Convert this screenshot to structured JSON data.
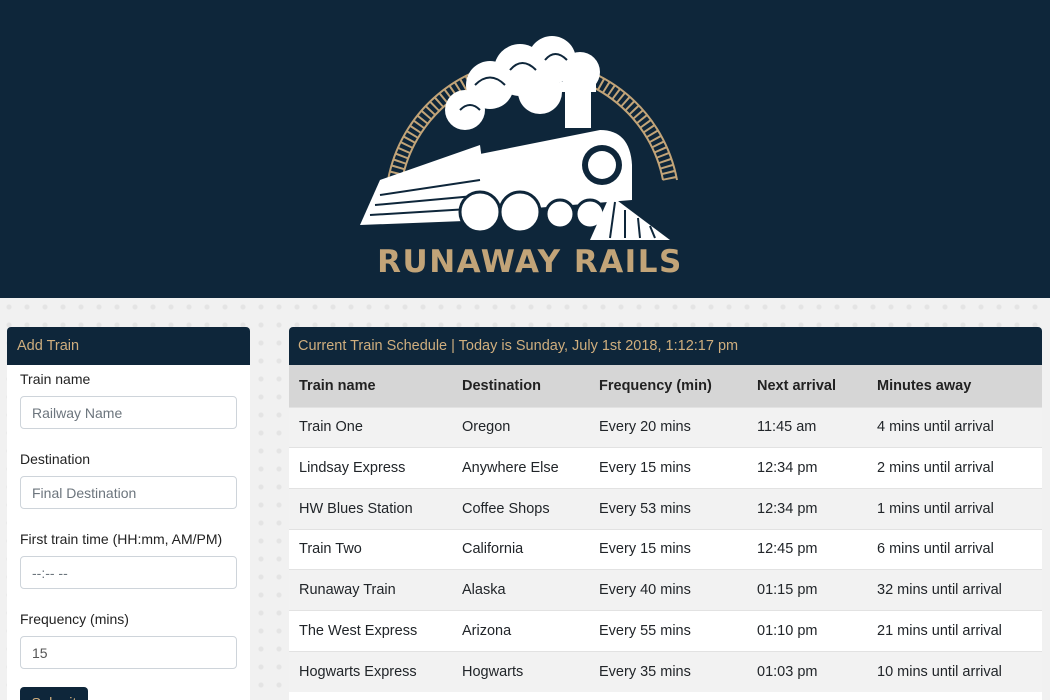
{
  "brand": {
    "name": "RUNAWAY RAILS"
  },
  "colors": {
    "navy": "#0e263a",
    "gold": "#c2a478",
    "header_text": "#cfae7e"
  },
  "add_train": {
    "title": "Add Train",
    "fields": [
      {
        "label": "Train name",
        "placeholder": "Railway Name",
        "value": ""
      },
      {
        "label": "Destination",
        "placeholder": "Final Destination",
        "value": ""
      },
      {
        "label": "First train time (HH:mm, AM/PM)",
        "placeholder": "--:-- --",
        "value": ""
      },
      {
        "label": "Frequency (mins)",
        "placeholder": "",
        "value": "15"
      }
    ],
    "submit_label": "Submit"
  },
  "schedule": {
    "title": "Current Train Schedule | Today is Sunday, July 1st 2018, 1:12:17 pm",
    "columns": [
      "Train name",
      "Destination",
      "Frequency (min)",
      "Next arrival",
      "Minutes away"
    ],
    "rows": [
      [
        "Train One",
        "Oregon",
        "Every 20 mins",
        "11:45 am",
        "4 mins until arrival"
      ],
      [
        "Lindsay Express",
        "Anywhere Else",
        "Every 15 mins",
        "12:34 pm",
        "2 mins until arrival"
      ],
      [
        "HW Blues Station",
        "Coffee Shops",
        "Every 53 mins",
        "12:34 pm",
        "1 mins until arrival"
      ],
      [
        "Train Two",
        "California",
        "Every 15 mins",
        "12:45 pm",
        "6 mins until arrival"
      ],
      [
        "Runaway Train",
        "Alaska",
        "Every 40 mins",
        "01:15 pm",
        "32 mins until arrival"
      ],
      [
        "The West Express",
        "Arizona",
        "Every 55 mins",
        "01:10 pm",
        "21 mins until arrival"
      ],
      [
        "Hogwarts Express",
        "Hogwarts",
        "Every 35 mins",
        "01:03 pm",
        "10 mins until arrival"
      ]
    ]
  }
}
